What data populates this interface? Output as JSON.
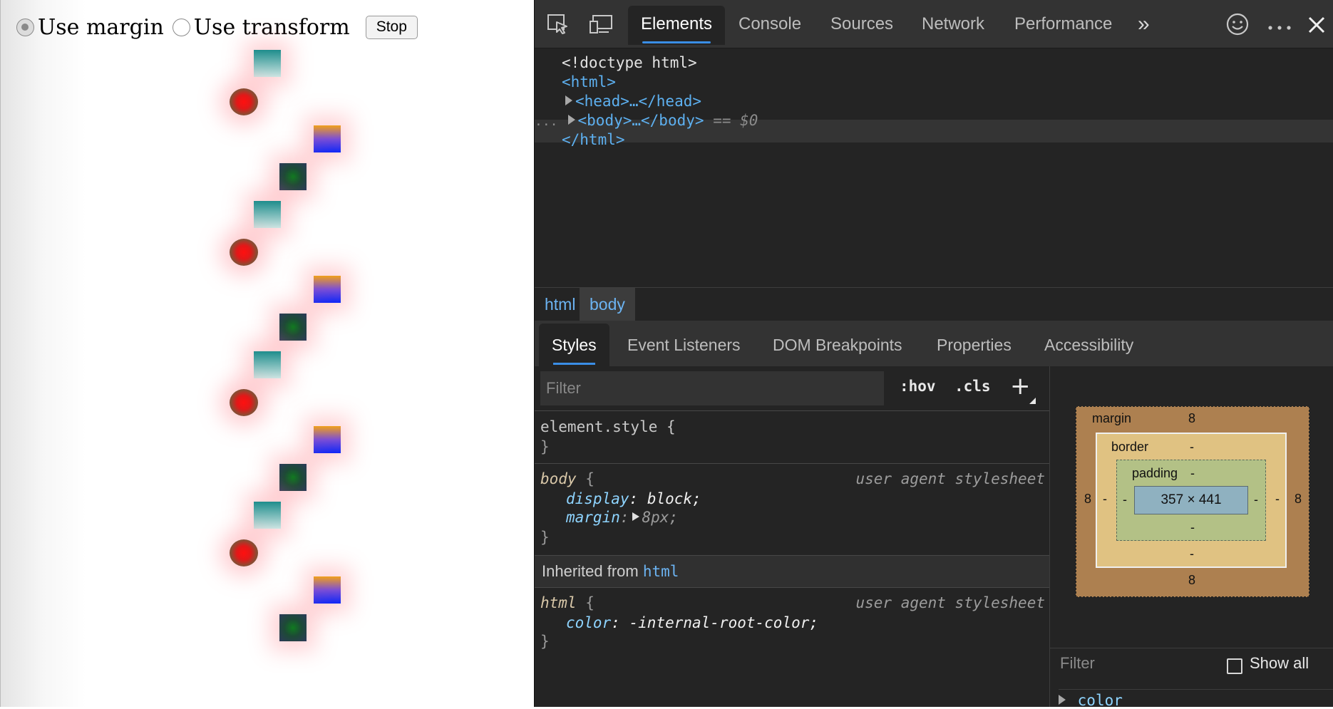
{
  "demo": {
    "options": [
      {
        "label": "Use margin",
        "selected": true
      },
      {
        "label": "Use transform",
        "selected": false
      }
    ],
    "stop_label": "Stop"
  },
  "devtools": {
    "tabs": [
      "Elements",
      "Console",
      "Sources",
      "Network",
      "Performance"
    ],
    "more_tabs": "»",
    "dom": {
      "doctype": "<!doctype html>",
      "html_open": "<html>",
      "head": "<head>…</head>",
      "body": "<body>…</body>",
      "selected_marker": "== $0",
      "html_close": "</html>",
      "ellipsis": "..."
    },
    "breadcrumbs": [
      "html",
      "body"
    ],
    "subtabs": [
      "Styles",
      "Event Listeners",
      "DOM Breakpoints",
      "Properties",
      "Accessibility"
    ],
    "styles": {
      "filter_placeholder": "Filter",
      "hov": ":hov",
      "cls": ".cls",
      "plus": "+",
      "element_style_selector": "element.style {",
      "close_brace": "}",
      "body_rule": {
        "selector": "body",
        "open": "{",
        "source": "user agent stylesheet",
        "declarations": [
          {
            "prop": "display",
            "value": "block;"
          },
          {
            "prop": "margin",
            "value": "8px;"
          }
        ]
      },
      "inherited_label": "Inherited from",
      "inherited_link": "html",
      "html_rule": {
        "selector": "html",
        "open": "{",
        "source": "user agent stylesheet",
        "declarations": [
          {
            "prop": "color",
            "value": "-internal-root-color;"
          }
        ]
      }
    },
    "box_model": {
      "margin_label": "margin",
      "margin": {
        "top": "8",
        "right": "8",
        "bottom": "8",
        "left": "8"
      },
      "border_label": "border",
      "border": {
        "top": "-",
        "right": "-",
        "bottom": "-",
        "left": "-"
      },
      "padding_label": "padding",
      "padding": {
        "top": "-",
        "right": "-",
        "bottom": "-",
        "left": "-"
      },
      "content": "357 × 441",
      "colors": {
        "margin": "#ad8050",
        "border": "#e0c282",
        "padding": "#b3c186",
        "content": "#8fb1c0"
      }
    },
    "computed": {
      "filter_placeholder": "Filter",
      "show_all_label": "Show all",
      "show_all_checked": false,
      "first_property": "color"
    }
  },
  "icons": [
    "inspect-icon",
    "device-toolbar-icon",
    "feedback-smiley-icon",
    "more-options-icon",
    "close-icon"
  ]
}
